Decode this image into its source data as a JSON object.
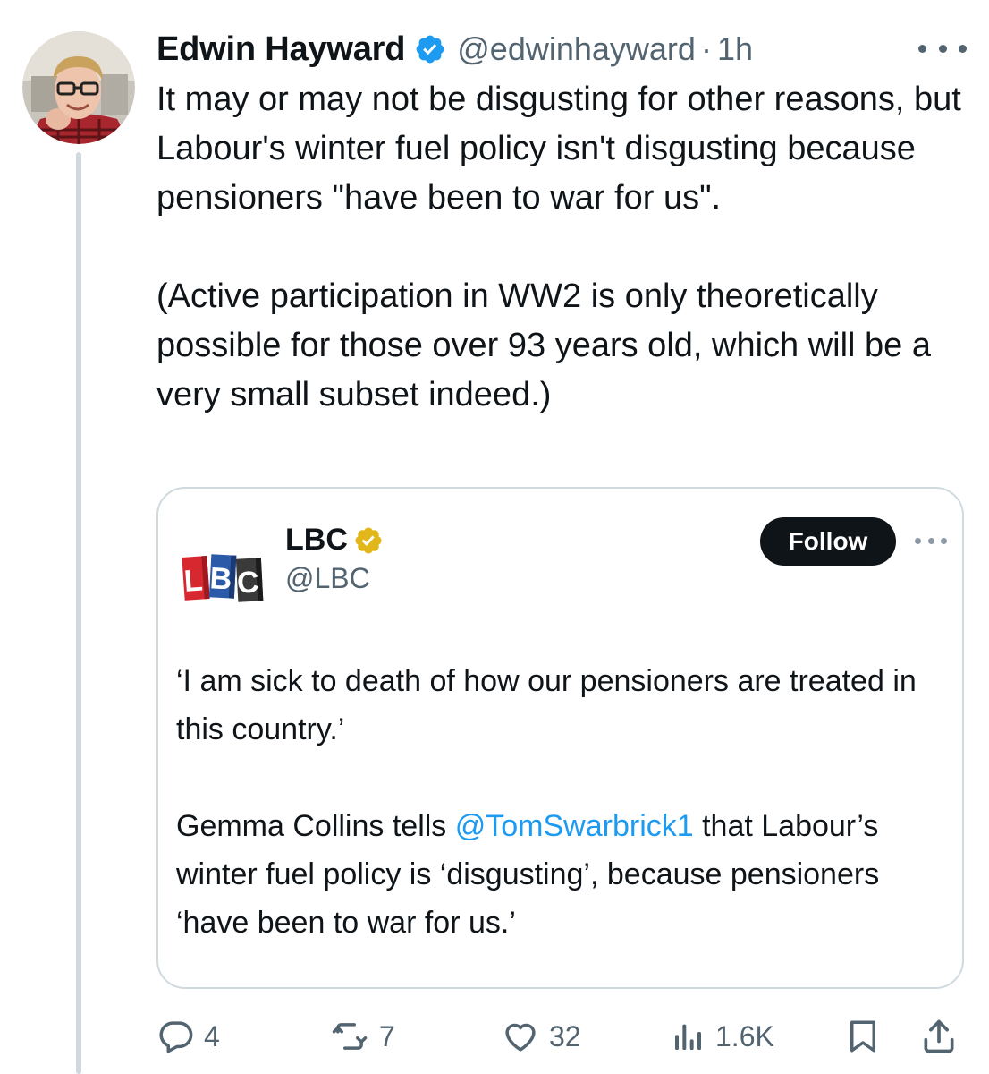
{
  "author": {
    "display_name": "Edwin Hayward",
    "verified": true,
    "handle": "@edwinhayward",
    "separator": "·",
    "timestamp": "1h",
    "avatar_icon": "user-avatar-photo"
  },
  "tweet": {
    "paragraphs": [
      "It may or may not be disgusting for other reasons, but Labour's winter fuel policy isn't disgusting because pensioners \"have been to war for us\".",
      "(Active participation in WW2 is only theoretically possible for those over 93 years old, which will be a very small subset indeed.)"
    ]
  },
  "quote": {
    "logo_text": "LBC",
    "name": "LBC",
    "verified_badge": "gold",
    "handle": "@LBC",
    "follow_label": "Follow",
    "paragraph1": "‘I am sick to death of how our pensioners are treated in this country.’",
    "paragraph2_before": "Gemma Collins tells ",
    "mention": "@TomSwarbrick1",
    "paragraph2_after": " that Labour’s winter fuel policy is ‘disgusting’, because pensioners ‘have been to war for us.’"
  },
  "actions": {
    "replies": "4",
    "reposts": "7",
    "likes": "32",
    "views": "1.6K"
  },
  "colors": {
    "text": "#0f1419",
    "secondary": "#536471",
    "accent": "#1d9bf0",
    "border": "#cfd9de",
    "gold_badge": "#e2b719",
    "lbc_red": "#d7282f",
    "lbc_blue": "#2b5aa8",
    "lbc_grey": "#3a3a3a"
  }
}
